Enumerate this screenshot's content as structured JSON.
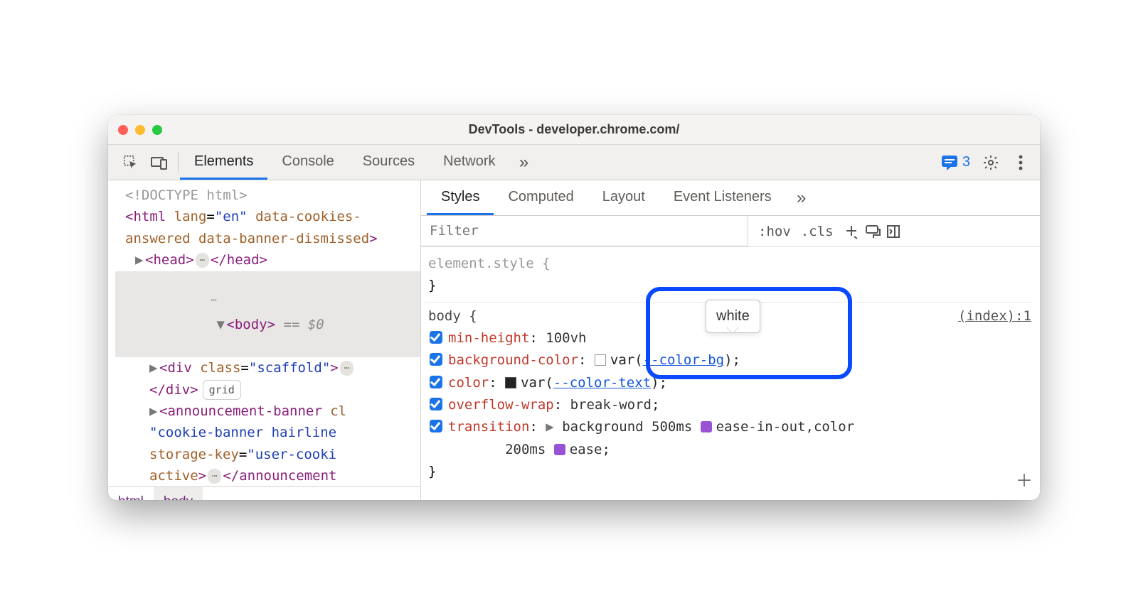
{
  "window": {
    "title": "DevTools - developer.chrome.com/"
  },
  "toolbar": {
    "tabs": [
      "Elements",
      "Console",
      "Sources",
      "Network"
    ],
    "active_tab": 0,
    "issues_count": "3"
  },
  "dom": {
    "doctype": "<!DOCTYPE html>",
    "html_open": {
      "tag": "html",
      "attrs_text": " lang=\"en\" data-cookies-answered data-banner-dismissed"
    },
    "head": "head",
    "body_line": {
      "tag": "body",
      "suffix": " == $0"
    },
    "scaffold_open": {
      "tag": "div",
      "attr": "class=\"scaffold\""
    },
    "grid_pill": "grid",
    "announcement": "announcement-banner cl \"cookie-banner hairline storage-key=\"user-cooki active>",
    "announcement_close": "</announcement"
  },
  "crumbs": [
    "html",
    "body"
  ],
  "styles": {
    "subtabs": [
      "Styles",
      "Computed",
      "Layout",
      "Event Listeners"
    ],
    "active_subtab": 0,
    "filter_placeholder": "Filter",
    "hov": ":hov",
    "cls": ".cls",
    "element_style": "element.style {",
    "close_brace": "}",
    "body_rule": {
      "selector": "body {",
      "source": "(index):1",
      "decls": [
        {
          "prop": "min-height",
          "val": "100vh"
        },
        {
          "prop": "background-color",
          "var": "--color-bg",
          "swatch": "white"
        },
        {
          "prop": "color",
          "var": "--color-text",
          "swatch": "dark"
        },
        {
          "prop": "overflow-wrap",
          "val": "break-word"
        },
        {
          "prop": "transition",
          "val1": "background 500ms",
          "ease1": "ease-in-out",
          "val2": ",color",
          "line2": "200ms",
          "ease2": "ease"
        }
      ]
    },
    "tooltip": "white"
  }
}
